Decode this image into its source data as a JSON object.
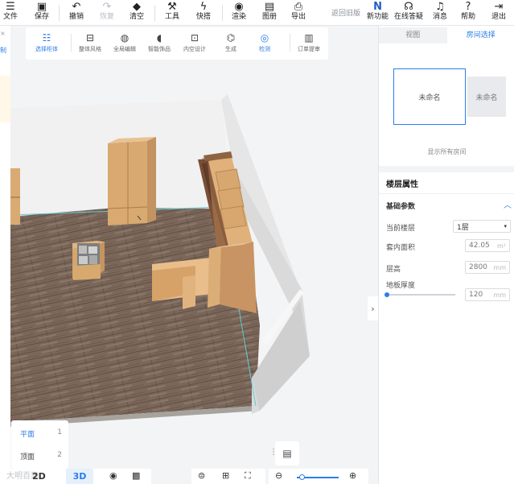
{
  "topbar": {
    "items": [
      {
        "label": "文件",
        "icon": "menu-icon"
      },
      {
        "label": "保存",
        "icon": "save-icon"
      },
      {
        "label": "撤销",
        "icon": "undo-icon"
      },
      {
        "label": "恢复",
        "icon": "redo-icon"
      },
      {
        "label": "清空",
        "icon": "eraser-icon"
      },
      {
        "label": "工具",
        "icon": "wrench-icon"
      },
      {
        "label": "快搭",
        "icon": "lightning-icon"
      },
      {
        "label": "渲染",
        "icon": "camera-icon"
      },
      {
        "label": "图册",
        "icon": "album-icon"
      },
      {
        "label": "导出",
        "icon": "export-icon"
      }
    ],
    "back_link": "返回旧版",
    "right_items": [
      {
        "label": "新功能",
        "icon": "new-feature-icon"
      },
      {
        "label": "在线答疑",
        "icon": "headset-icon"
      },
      {
        "label": "消息",
        "icon": "bell-icon"
      },
      {
        "label": "帮助",
        "icon": "help-icon"
      },
      {
        "label": "退出",
        "icon": "exit-icon"
      }
    ]
  },
  "left_strip": {
    "tab_label": "制"
  },
  "subbar": {
    "items": [
      {
        "label": "选择柜体",
        "icon": "select-cabinet-icon"
      },
      {
        "label": "整体风格",
        "icon": "style-icon"
      },
      {
        "label": "全局编辑",
        "icon": "global-edit-icon"
      },
      {
        "label": "智能饰品",
        "icon": "smart-decor-icon"
      },
      {
        "label": "内空设计",
        "icon": "interior-design-icon"
      },
      {
        "label": "生成",
        "icon": "generate-icon"
      },
      {
        "label": "检测",
        "icon": "check-icon"
      },
      {
        "label": "订单提审",
        "icon": "order-icon"
      }
    ]
  },
  "right_panel": {
    "tabs": [
      "视图",
      "房间选择"
    ],
    "rooms": [
      "未命名",
      "未命名"
    ],
    "show_all": "显示所有房间",
    "props_title": "楼层属性",
    "section_title": "基础参数",
    "current_floor_label": "当前楼层",
    "current_floor_value": "1层",
    "area_label": "套内面积",
    "area_value": "42.05",
    "area_unit": "m²",
    "height_label": "层高",
    "height_value": "2800",
    "height_unit": "mm",
    "thickness_label": "地板厚度",
    "thickness_value": "120",
    "thickness_unit": "mm",
    "thickness_level": 0.0
  },
  "view_list": {
    "items": [
      {
        "label": "平面",
        "num": "1"
      },
      {
        "label": "顶面",
        "num": "2"
      }
    ]
  },
  "bottom": {
    "mode_2d": "2D",
    "mode_3d": "3D",
    "watermark": "大明百果",
    "zoom_level": 0.05
  },
  "colors": {
    "accent": "#2b7de9",
    "floor": "#7d6a5c",
    "wood": "#d8ab75",
    "dark_wood": "#6e4a33",
    "wall": "#ededed"
  }
}
